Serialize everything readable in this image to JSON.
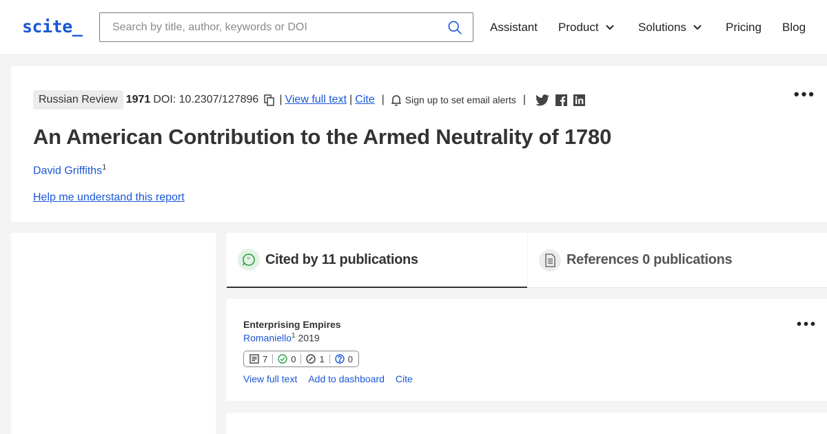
{
  "header": {
    "logo": "scite_",
    "search_placeholder": "Search by title, author, keywords or DOI",
    "nav": {
      "assistant": "Assistant",
      "product": "Product",
      "solutions": "Solutions",
      "pricing": "Pricing",
      "blog": "Blog"
    }
  },
  "article": {
    "journal": "Russian Review",
    "year": "1971",
    "doi": "DOI: 10.2307/127896",
    "view_full_text": "View full text",
    "cite": "Cite",
    "alerts": "Sign up to set email alerts",
    "title": "An American Contribution to the Armed Neutrality of 1780",
    "author": "David Griffiths",
    "author_sup": "1",
    "help_link": "Help me understand this report"
  },
  "tabs": {
    "cited_by": "Cited by 11 publications",
    "references": "References 0 publications"
  },
  "publications": [
    {
      "title": "Enterprising Empires",
      "author": "Romaniello",
      "author_sup": "1",
      "year": "2019",
      "stats": {
        "citing": "7",
        "supporting": "0",
        "mentioning": "1",
        "contrasting": "0"
      },
      "actions": {
        "view_full_text": "View full text",
        "add_to_dashboard": "Add to dashboard",
        "cite": "Cite"
      }
    }
  ],
  "colors": {
    "brand": "#1a56d6",
    "supporting": "#2e9e44",
    "contrasting": "#1a56d6"
  }
}
